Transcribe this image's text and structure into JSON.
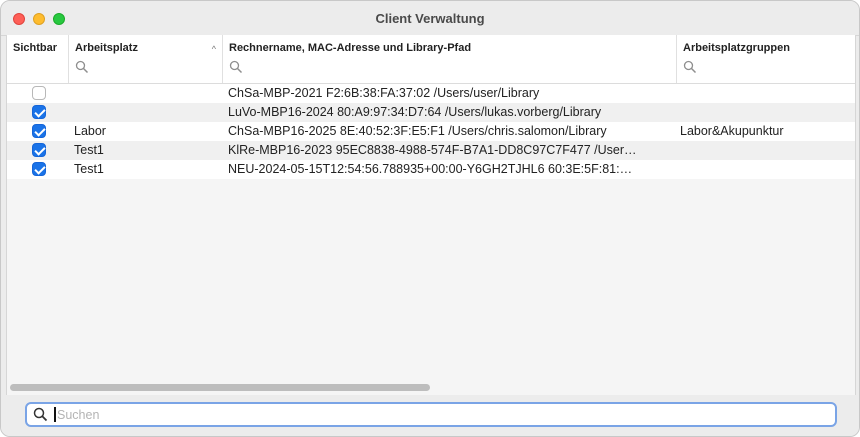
{
  "window": {
    "title": "Client Verwaltung"
  },
  "columns": {
    "sichtbar": "Sichtbar",
    "arbeitsplatz": "Arbeitsplatz",
    "rechner": "Rechnername, MAC-Adresse und Library-Pfad",
    "gruppen": "Arbeitsplatzgruppen"
  },
  "rows": [
    {
      "visible": false,
      "arbeitsplatz": "",
      "rechner": "ChSa-MBP-2021 F2:6B:38:FA:37:02 /Users/user/Library",
      "gruppen": ""
    },
    {
      "visible": true,
      "arbeitsplatz": "",
      "rechner": "LuVo-MBP16-2024 80:A9:97:34:D7:64 /Users/lukas.vorberg/Library",
      "gruppen": ""
    },
    {
      "visible": true,
      "arbeitsplatz": "Labor",
      "rechner": "ChSa-MBP16-2025 8E:40:52:3F:E5:F1 /Users/chris.salomon/Library",
      "gruppen": "Labor&Akupunktur"
    },
    {
      "visible": true,
      "arbeitsplatz": "Test1",
      "rechner": "KlRe-MBP16-2023 95EC8838-4988-574F-B7A1-DD8C97C7F477 /User…",
      "gruppen": ""
    },
    {
      "visible": true,
      "arbeitsplatz": "Test1",
      "rechner": "NEU-2024-05-15T12:54:56.788935+00:00-Y6GH2TJHL6 60:3E:5F:81:…",
      "gruppen": ""
    }
  ],
  "search": {
    "placeholder": "Suchen",
    "value": ""
  },
  "icons": {
    "column_filter": "search-icon",
    "sort": "chevron-up-icon",
    "bottom_search": "search-icon"
  },
  "colors": {
    "accent": "#1a73e8",
    "focus_ring": "#7aa4e6"
  }
}
